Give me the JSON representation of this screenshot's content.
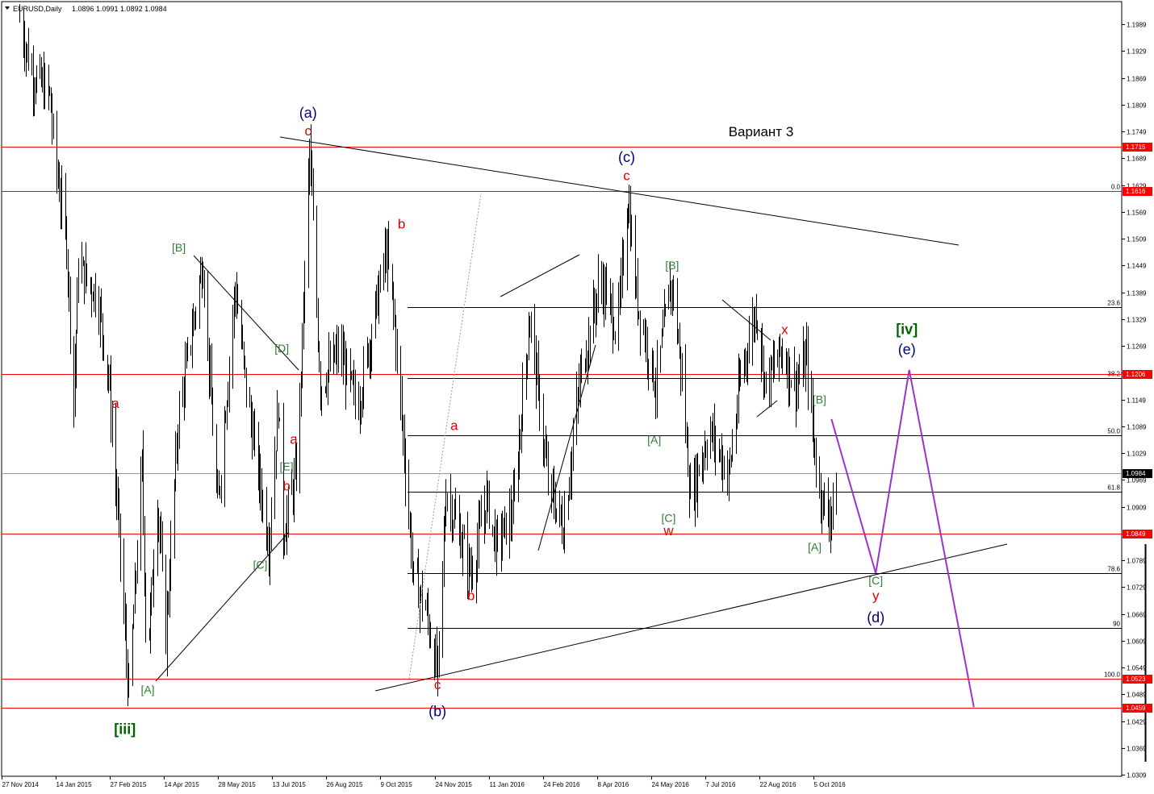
{
  "header": {
    "symbol": "EURUSD,Daily",
    "ohlc": "1.0896 1.0991 1.0892 1.0984"
  },
  "colors": {
    "background": "#ffffff",
    "bars": "#000000",
    "red_levels": "#ff0000",
    "projection": "#9933cc",
    "label_red": "#e00000",
    "label_green": "#2e7d32",
    "label_dark_green": "#006400",
    "label_navy": "#00007f"
  },
  "chart_data": {
    "type": "ohlc",
    "title": "Вариант 3",
    "ylim": [
      1.0309,
      1.2019
    ],
    "y_ticks": [
      "1.1989",
      "1.1929",
      "1.1869",
      "1.1809",
      "1.1749",
      "1.1689",
      "1.1629",
      "1.1569",
      "1.1509",
      "1.1449",
      "1.1389",
      "1.1329",
      "1.1269",
      "1.1209",
      "1.1149",
      "1.1089",
      "1.1029",
      "1.0969",
      "1.0909",
      "1.0849",
      "1.0789",
      "1.0729",
      "1.0669",
      "1.0609",
      "1.0549",
      "1.0489",
      "1.0429",
      "1.0369",
      "1.0309"
    ],
    "x_ticks": [
      "27 Nov 2014",
      "14 Jan 2015",
      "27 Feb 2015",
      "14 Apr 2015",
      "28 May 2015",
      "13 Jul 2015",
      "26 Aug 2015",
      "9 Oct 2015",
      "24 Nov 2015",
      "11 Jan 2016",
      "24 Feb 2016",
      "8 Apr 2016",
      "24 May 2016",
      "7 Jul 2016",
      "22 Aug 2016",
      "5 Oct 2016"
    ],
    "current_price": "1.0984",
    "price_levels": [
      {
        "value": 1.1715,
        "label": "1.1715"
      },
      {
        "value": 1.1616,
        "label": "1.1616"
      },
      {
        "value": 1.1206,
        "label": "1.1206"
      },
      {
        "value": 1.0849,
        "label": "1.0849"
      },
      {
        "value": 1.0523,
        "label": "1.0523"
      },
      {
        "value": 1.0459,
        "label": "1.0459"
      }
    ],
    "fibonacci": [
      {
        "level": "0.0",
        "value": 1.1616
      },
      {
        "level": "23.6",
        "value": 1.1355
      },
      {
        "level": "38.2",
        "value": 1.1196
      },
      {
        "level": "50.0",
        "value": 1.1069
      },
      {
        "level": "61.8",
        "value": 1.0942
      },
      {
        "level": "78.6",
        "value": 1.076
      },
      {
        "level": "90",
        "value": 1.0638
      },
      {
        "level": "100.0",
        "value": 1.0523
      }
    ],
    "wave_labels": [
      {
        "text": "(a)",
        "color": "navy",
        "date": "2015-08-10",
        "price": 1.178
      },
      {
        "text": "c",
        "color": "red",
        "date": "2015-08-10",
        "price": 1.174
      },
      {
        "text": "(c)",
        "color": "navy",
        "date": "2016-05-02",
        "price": 1.168
      },
      {
        "text": "c",
        "color": "red",
        "date": "2016-05-02",
        "price": 1.164
      },
      {
        "text": "b",
        "color": "red",
        "date": "2015-10-27",
        "price": 1.1532
      },
      {
        "text": "[B]",
        "color": "green",
        "date": "2015-04-24",
        "price": 1.148
      },
      {
        "text": "[B]",
        "color": "green",
        "date": "2016-06-09",
        "price": 1.144
      },
      {
        "text": "x",
        "color": "red",
        "date": "2016-09-11",
        "price": 1.1295
      },
      {
        "text": "[iv]",
        "color": "darkgreen",
        "date": "2016-12-22",
        "price": 1.1295
      },
      {
        "text": "(e)",
        "color": "navy",
        "date": "2016-12-22",
        "price": 1.125
      },
      {
        "text": "[D]",
        "color": "green",
        "date": "2015-07-19",
        "price": 1.1255
      },
      {
        "text": "a",
        "color": "red",
        "date": "2015-03-02",
        "price": 1.113
      },
      {
        "text": "[B]",
        "color": "green",
        "date": "2016-10-10",
        "price": 1.114
      },
      {
        "text": "a",
        "color": "red",
        "date": "2015-12-10",
        "price": 1.108
      },
      {
        "text": "a",
        "color": "red",
        "date": "2015-07-29",
        "price": 1.105
      },
      {
        "text": "[A]",
        "color": "green",
        "date": "2016-05-25",
        "price": 1.105
      },
      {
        "text": "[E]",
        "color": "green",
        "date": "2015-07-23",
        "price": 1.099
      },
      {
        "text": "b",
        "color": "red",
        "date": "2015-07-23",
        "price": 1.0945
      },
      {
        "text": "[C]",
        "color": "green",
        "date": "2016-06-06",
        "price": 1.0875
      },
      {
        "text": "w",
        "color": "red",
        "date": "2016-06-06",
        "price": 1.0845
      },
      {
        "text": "[A]",
        "color": "green",
        "date": "2016-10-06",
        "price": 1.081
      },
      {
        "text": "[C]",
        "color": "green",
        "date": "2015-07-01",
        "price": 1.077
      },
      {
        "text": "[C]",
        "color": "green",
        "date": "2016-11-26",
        "price": 1.0735
      },
      {
        "text": "b",
        "color": "red",
        "date": "2015-12-24",
        "price": 1.07
      },
      {
        "text": "y",
        "color": "red",
        "date": "2016-11-26",
        "price": 1.07
      },
      {
        "text": "(d)",
        "color": "navy",
        "date": "2016-11-26",
        "price": 1.065
      },
      {
        "text": "[A]",
        "color": "green",
        "date": "2015-03-29",
        "price": 1.049
      },
      {
        "text": "c",
        "color": "red",
        "date": "2015-11-26",
        "price": 1.05
      },
      {
        "text": "(b)",
        "color": "navy",
        "date": "2015-11-26",
        "price": 1.044
      },
      {
        "text": "[iii]",
        "color": "darkgreen",
        "date": "2015-03-10",
        "price": 1.04
      }
    ],
    "projection_path": [
      {
        "date": "2016-10-20",
        "price": 1.1105
      },
      {
        "date": "2016-11-26",
        "price": 1.076
      },
      {
        "date": "2016-12-24",
        "price": 1.1215
      },
      {
        "date": "2017-02-16",
        "price": 1.046
      }
    ]
  }
}
